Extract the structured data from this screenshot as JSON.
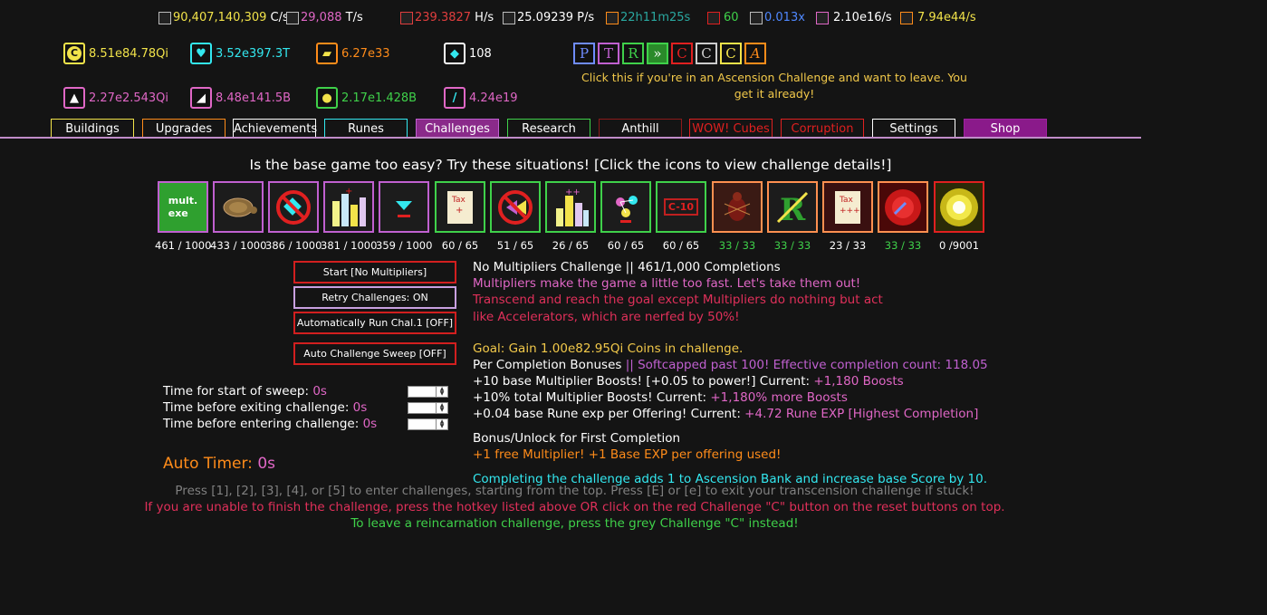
{
  "stats": [
    {
      "value": "90,407,140,309",
      "unit": "C/s",
      "color": "#f2e34a",
      "icon": "coin-rate-icon"
    },
    {
      "value": "29,088",
      "unit": "T/s",
      "color": "#e067c6",
      "icon": "tesseract-rate-icon"
    },
    {
      "value": "239.3827",
      "unit": "H/s",
      "color": "#e03e3e",
      "icon": "hypercube-rate-icon"
    },
    {
      "value": "25.09239",
      "unit": "P/s",
      "color": "#ffffff",
      "icon": "platonic-rate-icon"
    },
    {
      "value": "22h11m25s",
      "unit": "",
      "color": "#2aa8a0",
      "icon": "ascension-timer-icon"
    },
    {
      "value": "60",
      "unit": "",
      "color": "#3fd14a",
      "icon": "bank-icon"
    },
    {
      "value": "0.013x",
      "unit": "",
      "color": "#4f88ff",
      "icon": "speed-icon"
    },
    {
      "value": "2.10e16/s",
      "unit": "",
      "color": "#ffffff",
      "icon": "wand-icon"
    },
    {
      "value": "7.94e44/s",
      "unit": "",
      "color": "#f2e34a",
      "icon": "clock-icon"
    }
  ],
  "resources": [
    {
      "value": "8.51e84.78Qi",
      "color": "#f2e34a",
      "border": "#f2e34a",
      "icon": "coin-icon",
      "glyph": "C"
    },
    {
      "value": "3.52e397.3T",
      "color": "#33e8f0",
      "border": "#33e8f0",
      "icon": "diamond-icon",
      "glyph": "♥"
    },
    {
      "value": "6.27e33",
      "color": "#ff8c1a",
      "border": "#ff8c1a",
      "icon": "mythos-icon",
      "glyph": "▰"
    },
    {
      "value": "108",
      "color": "#ffffff",
      "border": "#ffffff",
      "icon": "particle-icon",
      "glyph": "◆"
    },
    {
      "value": "2.27e2.543Qi",
      "color": "#e067c6",
      "border": "#e067c6",
      "icon": "offering-icon",
      "glyph": "▲"
    },
    {
      "value": "8.48e141.5B",
      "color": "#e067c6",
      "border": "#e067c6",
      "icon": "obtainium-icon",
      "glyph": "◢"
    },
    {
      "value": "2.17e1.428B",
      "color": "#3fd14a",
      "border": "#3fd14a",
      "icon": "ascension-shard-icon",
      "glyph": "●"
    },
    {
      "value": "4.24e19",
      "color": "#e067c6",
      "border": "#e067c6",
      "icon": "quark-icon",
      "glyph": "/"
    }
  ],
  "resets": [
    {
      "glyph": "P",
      "color": "#6f8cff",
      "name": "prestige-reset-button"
    },
    {
      "glyph": "T",
      "color": "#c060d0",
      "name": "transcend-reset-button"
    },
    {
      "glyph": "R",
      "color": "#3fd14a",
      "name": "reincarnate-reset-button"
    },
    {
      "glyph": "»",
      "color": "#3fd14a",
      "name": "reincarnate-challenge-button"
    },
    {
      "glyph": "C",
      "color": "#e02020",
      "name": "transcend-challenge-exit-button"
    },
    {
      "glyph": "C",
      "color": "#cccccc",
      "name": "reincarnation-challenge-exit-button"
    },
    {
      "glyph": "C",
      "color": "#f2e34a",
      "name": "ascension-challenge-exit-button"
    },
    {
      "glyph": "A",
      "color": "#ff8c1a",
      "name": "ascend-reset-button"
    }
  ],
  "ascension_hint": "Click this if you're in an Ascension Challenge and want to leave. You get it already!",
  "tabs": [
    {
      "label": "Buildings",
      "color": "#f2e34a",
      "text": "#ffffff",
      "bg": "#141414"
    },
    {
      "label": "Upgrades",
      "color": "#ff8c1a",
      "text": "#ffffff",
      "bg": "#141414"
    },
    {
      "label": "Achievements",
      "color": "#ffffff",
      "text": "#ffffff",
      "bg": "#141414"
    },
    {
      "label": "Runes",
      "color": "#33e8f0",
      "text": "#ffffff",
      "bg": "#141414"
    },
    {
      "label": "Challenges",
      "color": "#c060d0",
      "text": "#ffffff",
      "bg": "#8a2a8a"
    },
    {
      "label": "Research",
      "color": "#3fd14a",
      "text": "#ffffff",
      "bg": "#141414"
    },
    {
      "label": "Anthill",
      "color": "#8b1a1a",
      "text": "#ffffff",
      "bg": "#141414"
    },
    {
      "label": "WOW! Cubes",
      "color": "#e02020",
      "text": "#e02020",
      "bg": "#141414"
    },
    {
      "label": "Corruption",
      "color": "#e02020",
      "text": "#e02020",
      "bg": "#141414"
    },
    {
      "label": "Settings",
      "color": "#ffffff",
      "text": "#ffffff",
      "bg": "#141414"
    },
    {
      "label": "Shop",
      "color": "#a020a0",
      "text": "#ffffff",
      "bg": "#8a1a8a"
    }
  ],
  "heading": "Is the base game too easy? Try these situations! [Click the icons to view challenge details!]",
  "challenges": [
    {
      "count": "461 / 1000",
      "border": "#c060d0",
      "countColor": "#ffffff",
      "icon": "multiplier-exe-icon",
      "label": "mult.\nexe"
    },
    {
      "count": "433 / 1000",
      "border": "#c060d0",
      "countColor": "#ffffff",
      "icon": "tortoise-icon",
      "label": ""
    },
    {
      "count": "386 / 1000",
      "border": "#c060d0",
      "countColor": "#ffffff",
      "icon": "no-crystal-icon",
      "label": ""
    },
    {
      "count": "381 / 1000",
      "border": "#c060d0",
      "countColor": "#ffffff",
      "icon": "city-icon",
      "label": ""
    },
    {
      "count": "359 / 1000",
      "border": "#c060d0",
      "countColor": "#ffffff",
      "icon": "diamond-minus-icon",
      "label": ""
    },
    {
      "count": "60 / 65",
      "border": "#3fd14a",
      "countColor": "#ffffff",
      "icon": "tax-scroll-icon",
      "label": ""
    },
    {
      "count": "51 / 65",
      "border": "#3fd14a",
      "countColor": "#ffffff",
      "icon": "no-accelerator-icon",
      "label": ""
    },
    {
      "count": "26 / 65",
      "border": "#3fd14a",
      "countColor": "#ffffff",
      "icon": "city-plus-icon",
      "label": ""
    },
    {
      "count": "60 / 65",
      "border": "#3fd14a",
      "countColor": "#ffffff",
      "icon": "molecule-icon",
      "label": ""
    },
    {
      "count": "60 / 65",
      "border": "#3fd14a",
      "countColor": "#ffffff",
      "icon": "c10-icon",
      "label": "C-10"
    },
    {
      "count": "33 / 33",
      "border": "#ff9050",
      "countColor": "#3fd14a",
      "icon": "ant-icon",
      "label": ""
    },
    {
      "count": "33 / 33",
      "border": "#ff9050",
      "countColor": "#3fd14a",
      "icon": "no-reincarnate-icon",
      "label": ""
    },
    {
      "count": "23 / 33",
      "border": "#ff9050",
      "countColor": "#ffffff",
      "icon": "tax-plus-icon",
      "label": ""
    },
    {
      "count": "33 / 33",
      "border": "#ff9050",
      "countColor": "#3fd14a",
      "icon": "red-orb-icon",
      "label": ""
    },
    {
      "count": "0 /9001",
      "border": "#e02020",
      "countColor": "#ffffff",
      "icon": "sun-icon",
      "label": ""
    }
  ],
  "buttons": {
    "start": "Start [No Multipliers]",
    "retry": "Retry Challenges: ON",
    "auto_run": "Automatically Run Chal.1 [OFF]",
    "auto_sweep": "Auto Challenge Sweep [OFF]"
  },
  "timers": [
    {
      "label": "Time for start of sweep: ",
      "value": "0s"
    },
    {
      "label": "Time before exiting challenge: ",
      "value": "0s"
    },
    {
      "label": "Time before entering challenge: ",
      "value": "0s"
    }
  ],
  "auto_timer": {
    "label": "Auto Timer: ",
    "value": "0s"
  },
  "details": {
    "title": "No Multipliers Challenge || 461/1,000 Completions",
    "desc1": "Multipliers make the game a little too fast. Let's take them out!",
    "desc2": "Transcend and reach the goal except Multipliers do nothing but act",
    "desc3": "like Accelerators, which are nerfed by 50%!",
    "goal": "Goal: Gain 1.00e82.95Qi Coins in challenge.",
    "per_label": "Per Completion Bonuses ",
    "per_soft": "|| Softcapped past 100! Effective completion count: 118.05",
    "bonus1a": "+10 base Multiplier Boosts! [+0.05 to power!] Current: ",
    "bonus1b": "+1,180 Boosts",
    "bonus2a": "+10% total Multiplier Boosts! Current: ",
    "bonus2b": "+1,180% more Boosts",
    "bonus3a": "+0.04 base Rune exp per Offering! Current: ",
    "bonus3b": "+4.72 Rune EXP [Highest Completion]",
    "first_title": "Bonus/Unlock for First Completion",
    "first_desc": "+1 free Multiplier! +1 Base EXP per offering used!",
    "bank": "Completing the challenge adds 1 to Ascension Bank and increase base Score by 10."
  },
  "footer": {
    "hotkeys": "Press [1], [2], [3], [4], or [5] to enter challenges, starting from the top. Press [E] or [e] to exit your transcension challenge if stuck!",
    "unable": "If you are unable to finish the challenge, press the hotkey listed above OR click on the red Challenge \"C\" button on the reset buttons on top.",
    "reincarnation": "To leave a reincarnation challenge, press the grey Challenge \"C\" instead!"
  }
}
